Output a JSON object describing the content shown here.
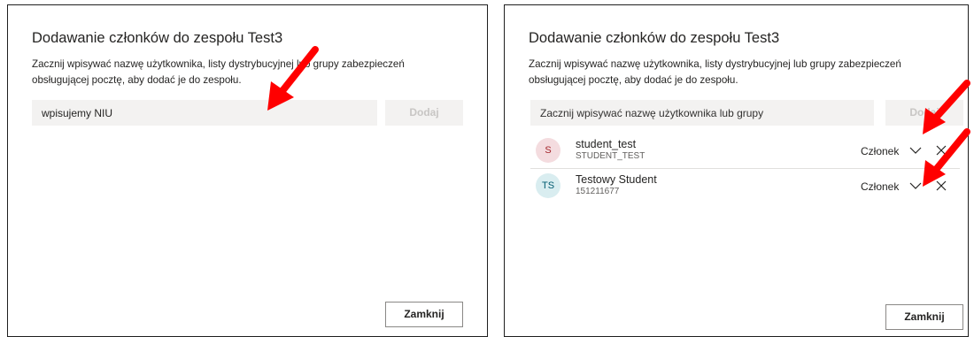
{
  "left_dialog": {
    "title": "Dodawanie członków do zespołu Test3",
    "description": "Zacznij wpisywać nazwę użytkownika, listy dystrybucyjnej lub grupy zabezpieczeń obsługującej pocztę, aby dodać je do zespołu.",
    "search_value": "wpisujemy NIU",
    "add_label": "Dodaj",
    "close_label": "Zamknij"
  },
  "right_dialog": {
    "title": "Dodawanie członków do zespołu Test3",
    "description": "Zacznij wpisywać nazwę użytkownika, listy dystrybucyjnej lub grupy zabezpieczeń obsługującej pocztę, aby dodać je do zespołu.",
    "search_placeholder": "Zacznij wpisywać nazwę użytkownika lub grupy",
    "add_label": "Dodaj",
    "close_label": "Zamknij",
    "members": [
      {
        "initials": "S",
        "name": "student_test",
        "sub": "STUDENT_TEST",
        "role": "Członek"
      },
      {
        "initials": "TS",
        "name": "Testowy Student",
        "sub": "151211677",
        "role": "Członek"
      }
    ]
  },
  "colors": {
    "annotation_arrow": "#ff0000",
    "avatar_s_bg": "#f4dcdf",
    "avatar_ts_bg": "#d9edf0",
    "disabled_text": "#c8c6c4",
    "input_bg": "#f3f2f1"
  },
  "icons": [
    "chevron-down-icon",
    "close-icon",
    "red-arrow-annotation"
  ]
}
